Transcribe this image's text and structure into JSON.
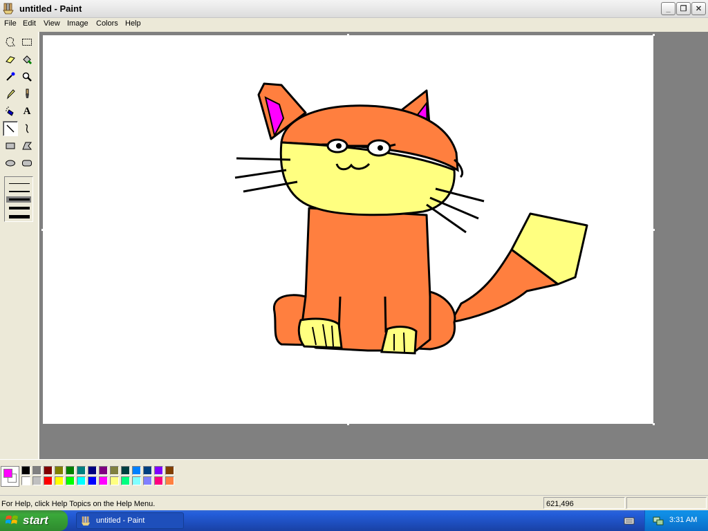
{
  "window": {
    "title": "untitled - Paint",
    "minimize_label": "_",
    "restore_label": "❐",
    "close_label": "✕"
  },
  "menu": {
    "items": [
      "File",
      "Edit",
      "View",
      "Image",
      "Colors",
      "Help"
    ]
  },
  "toolbox": {
    "tools": [
      {
        "name": "free-form-select-icon",
        "glyph": "⬚"
      },
      {
        "name": "select-icon",
        "glyph": "⬚"
      },
      {
        "name": "eraser-icon",
        "glyph": "▱"
      },
      {
        "name": "fill-with-color-icon",
        "glyph": "◈"
      },
      {
        "name": "pick-color-icon",
        "glyph": "✒"
      },
      {
        "name": "magnifier-icon",
        "glyph": "🔍"
      },
      {
        "name": "pencil-icon",
        "glyph": "✎"
      },
      {
        "name": "brush-icon",
        "glyph": "🖌"
      },
      {
        "name": "airbrush-icon",
        "glyph": "✈"
      },
      {
        "name": "text-icon",
        "glyph": "A"
      },
      {
        "name": "line-icon",
        "glyph": "╲"
      },
      {
        "name": "curve-icon",
        "glyph": "∿"
      },
      {
        "name": "rectangle-icon",
        "glyph": "▭"
      },
      {
        "name": "polygon-icon",
        "glyph": "⏢"
      },
      {
        "name": "ellipse-icon",
        "glyph": "⬭"
      },
      {
        "name": "rounded-rectangle-icon",
        "glyph": "▢"
      }
    ],
    "selected_tool": "line-icon"
  },
  "palette": {
    "foreground": "#ff00ff",
    "background": "#ffffff",
    "colors_top": [
      "#000000",
      "#808080",
      "#800000",
      "#808000",
      "#008000",
      "#008080",
      "#000080",
      "#800080",
      "#808040",
      "#004040",
      "#0080ff",
      "#004080",
      "#8000ff",
      "#804000"
    ],
    "colors_bottom": [
      "#ffffff",
      "#c0c0c0",
      "#ff0000",
      "#ffff00",
      "#00ff00",
      "#00ffff",
      "#0000ff",
      "#ff00ff",
      "#ffff80",
      "#00ff80",
      "#80ffff",
      "#8080ff",
      "#ff0080",
      "#ff8040"
    ]
  },
  "drawing": {
    "colors": {
      "outline": "#000000",
      "fur": "#ff7f3f",
      "light": "#ffff80",
      "inner_ear": "#ff00ff",
      "glasses_fill": "#ffffff"
    }
  },
  "status": {
    "help_text": "For Help, click Help Topics on the Help Menu.",
    "coordinates": "621,496"
  },
  "taskbar": {
    "start_label": "start",
    "task_label": "untitled - Paint",
    "clock": "3:31 AM"
  }
}
